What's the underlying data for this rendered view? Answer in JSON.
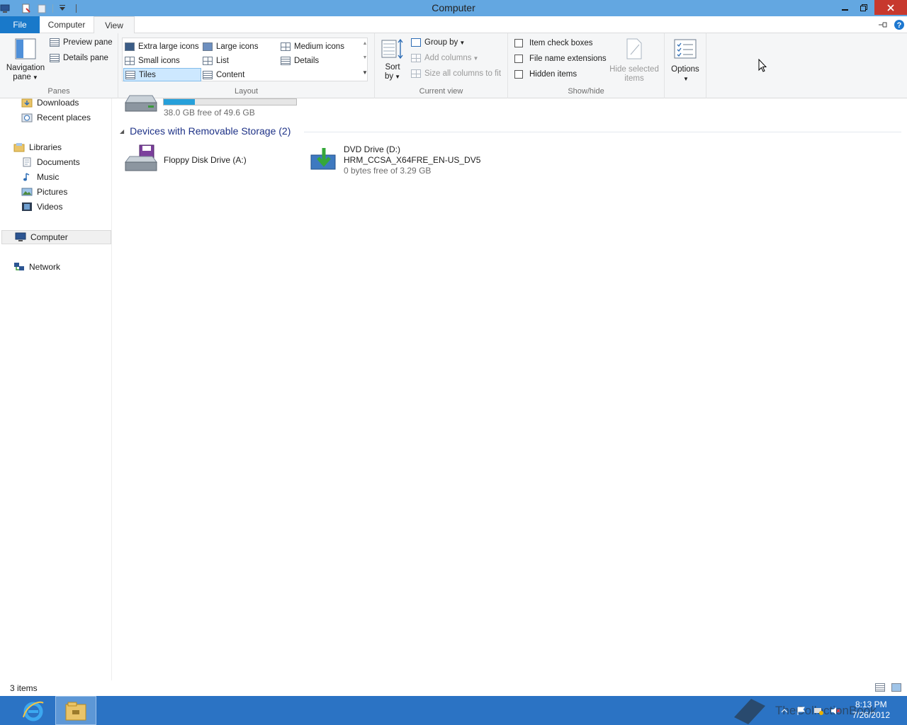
{
  "window": {
    "title": "Computer"
  },
  "tabs": {
    "file": "File",
    "computer": "Computer",
    "view": "View"
  },
  "ribbon": {
    "panes": {
      "label": "Panes",
      "navigation_pane_line1": "Navigation",
      "navigation_pane_line2": "pane",
      "preview_pane": "Preview pane",
      "details_pane": "Details pane"
    },
    "layout": {
      "label": "Layout",
      "options": [
        "Extra large icons",
        "Large icons",
        "Medium icons",
        "Small icons",
        "List",
        "Details",
        "Tiles",
        "Content"
      ],
      "selected": "Tiles"
    },
    "current_view": {
      "label": "Current view",
      "sort_by_line1": "Sort",
      "sort_by_line2": "by",
      "group_by": "Group by",
      "add_columns": "Add columns",
      "size_columns": "Size all columns to fit"
    },
    "show_hide": {
      "label": "Show/hide",
      "item_check_boxes": "Item check boxes",
      "file_name_extensions": "File name extensions",
      "hidden_items": "Hidden items",
      "hide_selected_line1": "Hide selected",
      "hide_selected_line2": "items",
      "item_check_boxes_checked": false,
      "file_name_extensions_checked": false,
      "hidden_items_checked": false
    },
    "options": {
      "label": "Options"
    }
  },
  "nav": {
    "downloads": "Downloads",
    "recent_places": "Recent places",
    "libraries": "Libraries",
    "documents": "Documents",
    "music": "Music",
    "pictures": "Pictures",
    "videos": "Videos",
    "computer": "Computer",
    "network": "Network"
  },
  "content": {
    "local_disk": {
      "free_text": "38.0 GB free of 49.6 GB",
      "used_fraction": 0.234
    },
    "removable_header": "Devices with Removable Storage (2)",
    "floppy": {
      "name": "Floppy Disk Drive (A:)"
    },
    "dvd": {
      "name": "DVD Drive (D:)",
      "label": "HRM_CCSA_X64FRE_EN-US_DV5",
      "free_text": "0 bytes free of 3.29 GB"
    }
  },
  "status": {
    "item_count": "3 items"
  },
  "taskbar": {
    "time": "8:13 PM",
    "date": "7/26/2012",
    "watermark": "TheCollectionBook"
  },
  "colors": {
    "titlebar": "#63a7e1",
    "file_tab": "#1979ca",
    "close_button": "#c7382d",
    "taskbar": "#2b73c4",
    "header_text": "#1e3287",
    "drive_fill": "#26a0da"
  }
}
